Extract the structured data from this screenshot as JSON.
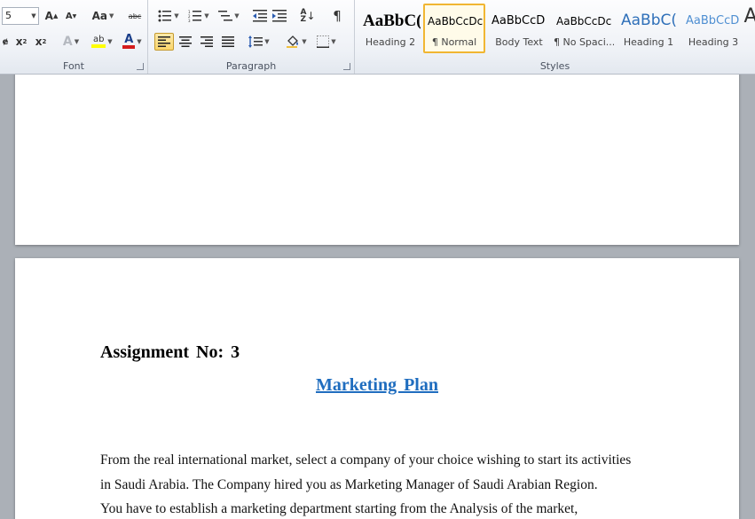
{
  "ribbon": {
    "font_group": {
      "label": "Font",
      "font_size_value": "5",
      "grow_font": "A",
      "shrink_font": "A",
      "change_case": "Aa",
      "strike": "abc",
      "subscript": "x",
      "superscript": "x",
      "text_effects": "A",
      "highlight": "ab",
      "font_color": "A",
      "font_color_hex": "#d41c1c",
      "highlight_hex": "#ffff00"
    },
    "paragraph_group": {
      "label": "Paragraph",
      "pilcrow": "¶"
    },
    "styles_group": {
      "label": "Styles",
      "change_styles": "A",
      "tiles": [
        {
          "sample": "AaBbC(",
          "name": "Heading 2"
        },
        {
          "sample": "AaBbCcDc",
          "name": "¶ Normal"
        },
        {
          "sample": "AaBbCcD",
          "name": "Body Text"
        },
        {
          "sample": "AaBbCcDc",
          "name": "¶ No Spaci..."
        },
        {
          "sample": "AaBbC(",
          "name": "Heading 1"
        },
        {
          "sample": "AaBbCcD",
          "name": "Heading 3"
        }
      ]
    }
  },
  "document": {
    "assignment_title": "Assignment  No: 3",
    "plan_title": "Marketing  Plan",
    "paragraph_lines": [
      "From the real international market, select a company of your choice wishing to start its activities",
      "in Saudi Arabia. The Company hired you as Marketing Manager of Saudi Arabian Region.",
      "You have to establish a marketing department starting from the Analysis of the market,"
    ],
    "accent_color": "#1f6dbf"
  }
}
